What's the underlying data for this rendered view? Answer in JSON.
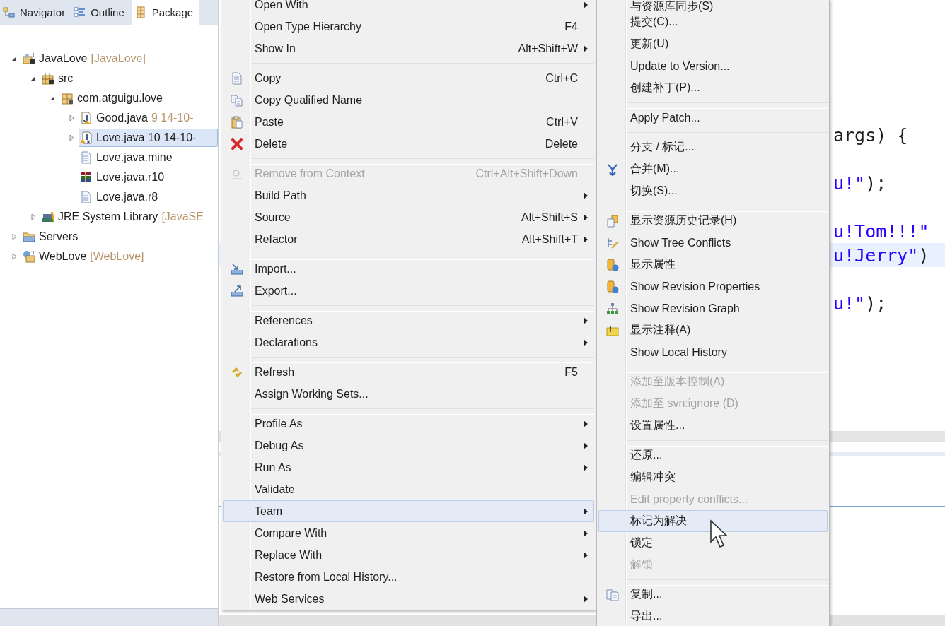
{
  "view_tabs": [
    {
      "label": "Navigator",
      "selected": false
    },
    {
      "label": "Outline",
      "selected": false
    },
    {
      "label": "Package",
      "selected": true
    }
  ],
  "tree": [
    {
      "kind": "project",
      "label": "JavaLove",
      "decoration": "[JavaLove]",
      "expanded": true,
      "selected": false,
      "children": [
        {
          "kind": "source_folder",
          "label": "src",
          "expanded": true,
          "selected": false,
          "children": [
            {
              "kind": "package",
              "label": "com.atguigu.love",
              "expanded": true,
              "selected": false,
              "children": [
                {
                  "kind": "java_file",
                  "label": "Good.java",
                  "decoration": "9  14-10-",
                  "expanded": false,
                  "selected": false
                },
                {
                  "kind": "java_conflict",
                  "label": "Love.java 10  14-10-",
                  "expanded": false,
                  "selected": true
                },
                {
                  "kind": "text_file",
                  "label": "Love.java.mine",
                  "selected": false
                },
                {
                  "kind": "archive_file",
                  "label": "Love.java.r10",
                  "selected": false
                },
                {
                  "kind": "text_file",
                  "label": "Love.java.r8",
                  "selected": false
                }
              ]
            }
          ]
        },
        {
          "kind": "library",
          "label": "JRE System Library",
          "decoration": "[JavaSE",
          "expanded": false,
          "selected": false
        }
      ]
    },
    {
      "kind": "folder",
      "label": "Servers",
      "expanded": false,
      "selected": false
    },
    {
      "kind": "web_project",
      "label": "WebLove",
      "decoration": "[WebLove]",
      "expanded": false,
      "selected": false
    }
  ],
  "context_menu": {
    "groups": [
      [
        {
          "label": "Open With",
          "submenu": true,
          "disabled": false,
          "selected": false
        },
        {
          "label": "Open Type Hierarchy",
          "shortcut": "F4",
          "submenu": false,
          "disabled": false,
          "selected": false
        },
        {
          "label": "Show In",
          "shortcut": "Alt+Shift+W",
          "submenu": true,
          "disabled": false,
          "selected": false
        }
      ],
      [
        {
          "label": "Copy",
          "shortcut": "Ctrl+C",
          "submenu": false,
          "disabled": false,
          "selected": false
        },
        {
          "label": "Copy Qualified Name",
          "submenu": false,
          "disabled": false,
          "selected": false
        },
        {
          "label": "Paste",
          "shortcut": "Ctrl+V",
          "submenu": false,
          "disabled": false,
          "selected": false
        },
        {
          "label": "Delete",
          "shortcut": "Delete",
          "submenu": false,
          "disabled": false,
          "selected": false
        }
      ],
      [
        {
          "label": "Remove from Context",
          "shortcut": "Ctrl+Alt+Shift+Down",
          "submenu": false,
          "disabled": true,
          "selected": false
        },
        {
          "label": "Build Path",
          "submenu": true,
          "disabled": false,
          "selected": false
        },
        {
          "label": "Source",
          "shortcut": "Alt+Shift+S",
          "submenu": true,
          "disabled": false,
          "selected": false
        },
        {
          "label": "Refactor",
          "shortcut": "Alt+Shift+T",
          "submenu": true,
          "disabled": false,
          "selected": false
        }
      ],
      [
        {
          "label": "Import...",
          "submenu": false,
          "disabled": false,
          "selected": false
        },
        {
          "label": "Export...",
          "submenu": false,
          "disabled": false,
          "selected": false
        }
      ],
      [
        {
          "label": "References",
          "submenu": true,
          "disabled": false,
          "selected": false
        },
        {
          "label": "Declarations",
          "submenu": true,
          "disabled": false,
          "selected": false
        }
      ],
      [
        {
          "label": "Refresh",
          "shortcut": "F5",
          "submenu": false,
          "disabled": false,
          "selected": false
        },
        {
          "label": "Assign Working Sets...",
          "submenu": false,
          "disabled": false,
          "selected": false
        }
      ],
      [
        {
          "label": "Profile As",
          "submenu": true,
          "disabled": false,
          "selected": false
        },
        {
          "label": "Debug As",
          "submenu": true,
          "disabled": false,
          "selected": false
        },
        {
          "label": "Run As",
          "submenu": true,
          "disabled": false,
          "selected": false
        },
        {
          "label": "Validate",
          "submenu": false,
          "disabled": false,
          "selected": false
        },
        {
          "label": "Team",
          "submenu": true,
          "disabled": false,
          "selected": true
        },
        {
          "label": "Compare With",
          "submenu": true,
          "disabled": false,
          "selected": false
        },
        {
          "label": "Replace With",
          "submenu": true,
          "disabled": false,
          "selected": false
        },
        {
          "label": "Restore from Local History...",
          "submenu": false,
          "disabled": false,
          "selected": false
        },
        {
          "label": "Web Services",
          "submenu": true,
          "disabled": false,
          "selected": false
        }
      ]
    ]
  },
  "team_submenu": {
    "groups": [
      [
        {
          "label": "与资源库同步(S)",
          "disabled": false,
          "selected": false
        },
        {
          "label": "提交(C)...",
          "disabled": false,
          "selected": false
        },
        {
          "label": "更新(U)",
          "disabled": false,
          "selected": false
        },
        {
          "label": "Update to Version...",
          "disabled": false,
          "selected": false
        },
        {
          "label": "创建补丁(P)...",
          "disabled": false,
          "selected": false
        }
      ],
      [
        {
          "label": "Apply Patch...",
          "disabled": false,
          "selected": false
        }
      ],
      [
        {
          "label": "分支 / 标记...",
          "disabled": false,
          "selected": false
        },
        {
          "label": "合并(M)...",
          "disabled": false,
          "selected": false
        },
        {
          "label": "切换(S)...",
          "disabled": false,
          "selected": false
        }
      ],
      [
        {
          "label": "显示资源历史记录(H)",
          "disabled": false,
          "selected": false
        },
        {
          "label": "Show Tree Conflicts",
          "disabled": false,
          "selected": false
        },
        {
          "label": "显示属性",
          "disabled": false,
          "selected": false
        },
        {
          "label": "Show Revision Properties",
          "disabled": false,
          "selected": false
        },
        {
          "label": "Show Revision Graph",
          "disabled": false,
          "selected": false
        },
        {
          "label": "显示注释(A)",
          "disabled": false,
          "selected": false
        },
        {
          "label": "Show Local History",
          "disabled": false,
          "selected": false
        }
      ],
      [
        {
          "label": "添加至版本控制(A)",
          "disabled": true,
          "selected": false
        },
        {
          "label": "添加至 svn:ignore (D)",
          "disabled": true,
          "selected": false
        },
        {
          "label": "设置属性...",
          "disabled": false,
          "selected": false
        }
      ],
      [
        {
          "label": "还原...",
          "disabled": false,
          "selected": false
        },
        {
          "label": "编辑冲突",
          "disabled": false,
          "selected": false
        },
        {
          "label": "Edit property conflicts...",
          "disabled": true,
          "selected": false
        },
        {
          "label": "标记为解决",
          "disabled": false,
          "selected": true
        },
        {
          "label": "锁定",
          "disabled": false,
          "selected": false
        },
        {
          "label": "解锁",
          "disabled": true,
          "selected": false
        }
      ],
      [
        {
          "label": "复制...",
          "disabled": false,
          "selected": false
        },
        {
          "label": "导出...",
          "disabled": false,
          "selected": false
        }
      ]
    ]
  },
  "editor": {
    "lines": [
      {
        "highlighted": false,
        "segments": [
          {
            "kind": "plain",
            "text": "args) {"
          }
        ]
      },
      {
        "highlighted": false,
        "segments": [
          {
            "kind": "string",
            "text": "u!\""
          },
          {
            "kind": "plain",
            "text": ");"
          }
        ]
      },
      {
        "highlighted": false,
        "segments": [
          {
            "kind": "string",
            "text": "u!Tom!!!\""
          }
        ]
      },
      {
        "highlighted": true,
        "segments": [
          {
            "kind": "string",
            "text": "u!Jerry\""
          },
          {
            "kind": "plain",
            "text": ")"
          }
        ]
      },
      {
        "highlighted": false,
        "segments": [
          {
            "kind": "string",
            "text": "u!\""
          },
          {
            "kind": "plain",
            "text": ");"
          }
        ]
      }
    ]
  }
}
